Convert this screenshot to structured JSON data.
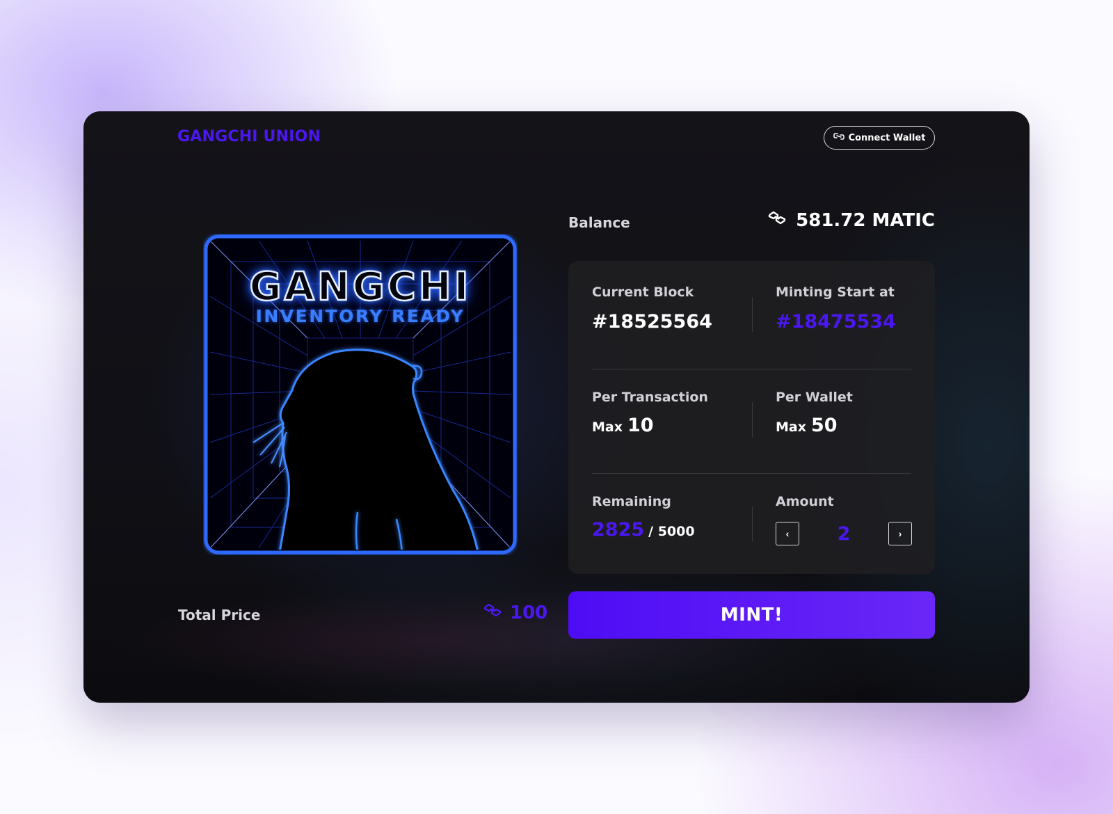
{
  "header": {
    "brand": "GANGCHI UNION",
    "connect_wallet_label": "Connect Wallet"
  },
  "artwork": {
    "title": "GANGCHI",
    "subtitle": "INVENTORY READY"
  },
  "balance": {
    "label": "Balance",
    "value": "581.72 MATIC",
    "icon": "matic-icon"
  },
  "stats": {
    "current_block": {
      "label": "Current Block",
      "value": "#18525564"
    },
    "minting_start": {
      "label": "Minting Start at",
      "value": "#18475534"
    },
    "per_transaction": {
      "label": "Per Transaction",
      "prefix": "Max",
      "value": "10"
    },
    "per_wallet": {
      "label": "Per Wallet",
      "prefix": "Max",
      "value": "50"
    },
    "remaining": {
      "label": "Remaining",
      "value": "2825",
      "total": "/ 5000"
    },
    "amount": {
      "label": "Amount",
      "value": "2",
      "decrement": "‹",
      "increment": "›"
    }
  },
  "total": {
    "label": "Total Price",
    "value": "100",
    "icon": "matic-icon"
  },
  "mint_label": "MINT!",
  "colors": {
    "accent": "#4b17f0",
    "button_gradient_start": "#4e0cf5",
    "button_gradient_end": "#6a27f7",
    "card_background": "#121216",
    "panel_background": "#1e1e22",
    "neon_blue": "#2f6bff"
  }
}
